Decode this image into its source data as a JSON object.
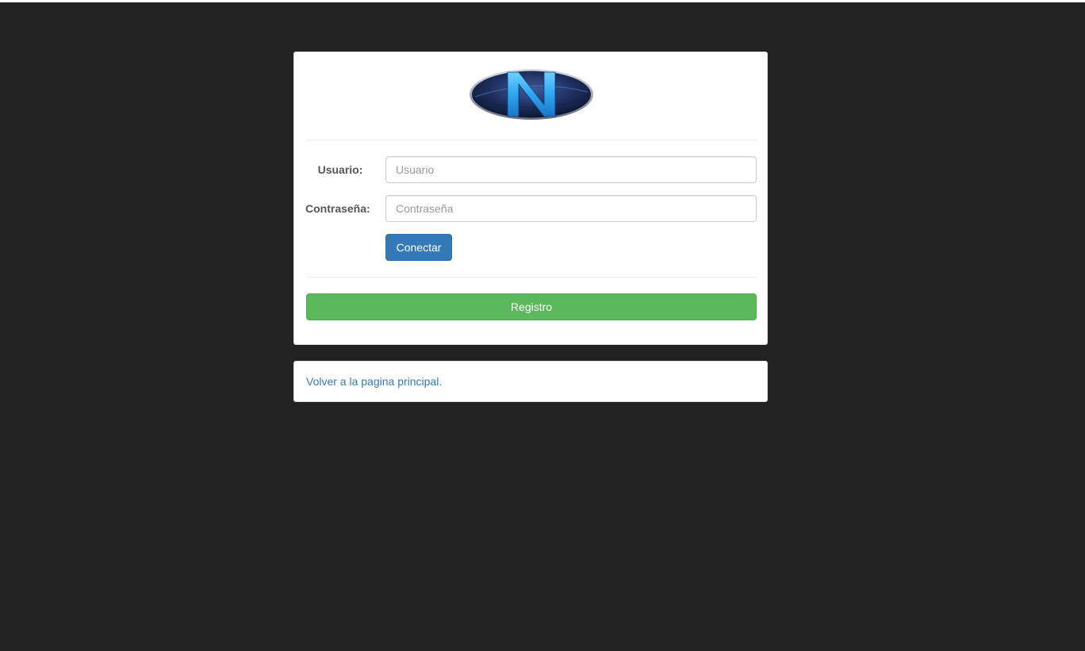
{
  "login": {
    "user_label": "Usuario:",
    "user_placeholder": "Usuario",
    "password_label": "Contraseña:",
    "password_placeholder": "Contraseña",
    "connect_label": "Conectar",
    "register_label": "Registro"
  },
  "footer": {
    "home_link": "Volver a la pagina principal."
  },
  "logo": {
    "letter": "N",
    "icon": "n-logo-emblem"
  },
  "colors": {
    "background": "#222222",
    "primary": "#337ab7",
    "success": "#5cb85c",
    "logo_dark": "#1b2a55",
    "logo_letter": "#2fa6f0"
  }
}
